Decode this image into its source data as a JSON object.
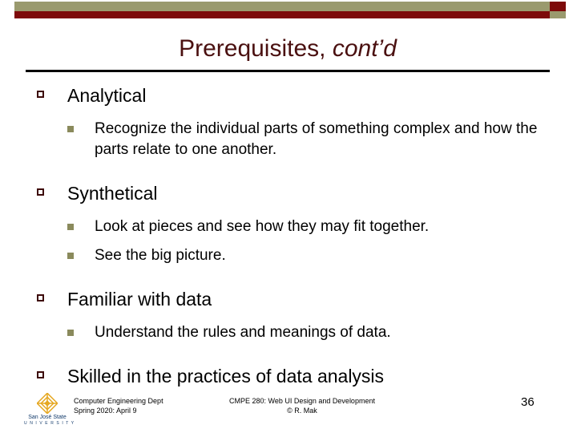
{
  "deco": {
    "bar_olive_color": "#9a9a6e",
    "bar_red_color": "#7d0a0a"
  },
  "title": {
    "main": "Prerequisites,",
    "italic": "cont’d",
    "color": "#4a1010"
  },
  "bullets": {
    "level1_marker": "hollow-square-icon",
    "level2_marker": "filled-square-icon",
    "level1_marker_color": "#3d0a0a",
    "level2_marker_color": "#8a8a5c"
  },
  "content": {
    "groups": [
      {
        "heading": "Analytical",
        "items": [
          "Recognize the individual parts of something complex and how the parts relate to one another."
        ]
      },
      {
        "heading": "Synthetical",
        "items": [
          "Look at pieces and see how they may fit together.",
          "See the big picture."
        ]
      },
      {
        "heading": "Familiar with data",
        "items": [
          "Understand the rules and meanings of data."
        ]
      },
      {
        "heading": "Skilled in the practices of data analysis",
        "items": []
      }
    ]
  },
  "footer": {
    "logo": {
      "name": "San José State",
      "subtitle": "U N I V E R S I T Y",
      "mark": "sjsu-diamond-logo",
      "gold": "#e5a823",
      "blue": "#123a6b"
    },
    "left_line1": "Computer Engineering Dept",
    "left_line2": "Spring 2020: April 9",
    "center_line1": "CMPE 280: Web UI Design and Development",
    "center_line2": "© R. Mak",
    "page_number": "36"
  }
}
